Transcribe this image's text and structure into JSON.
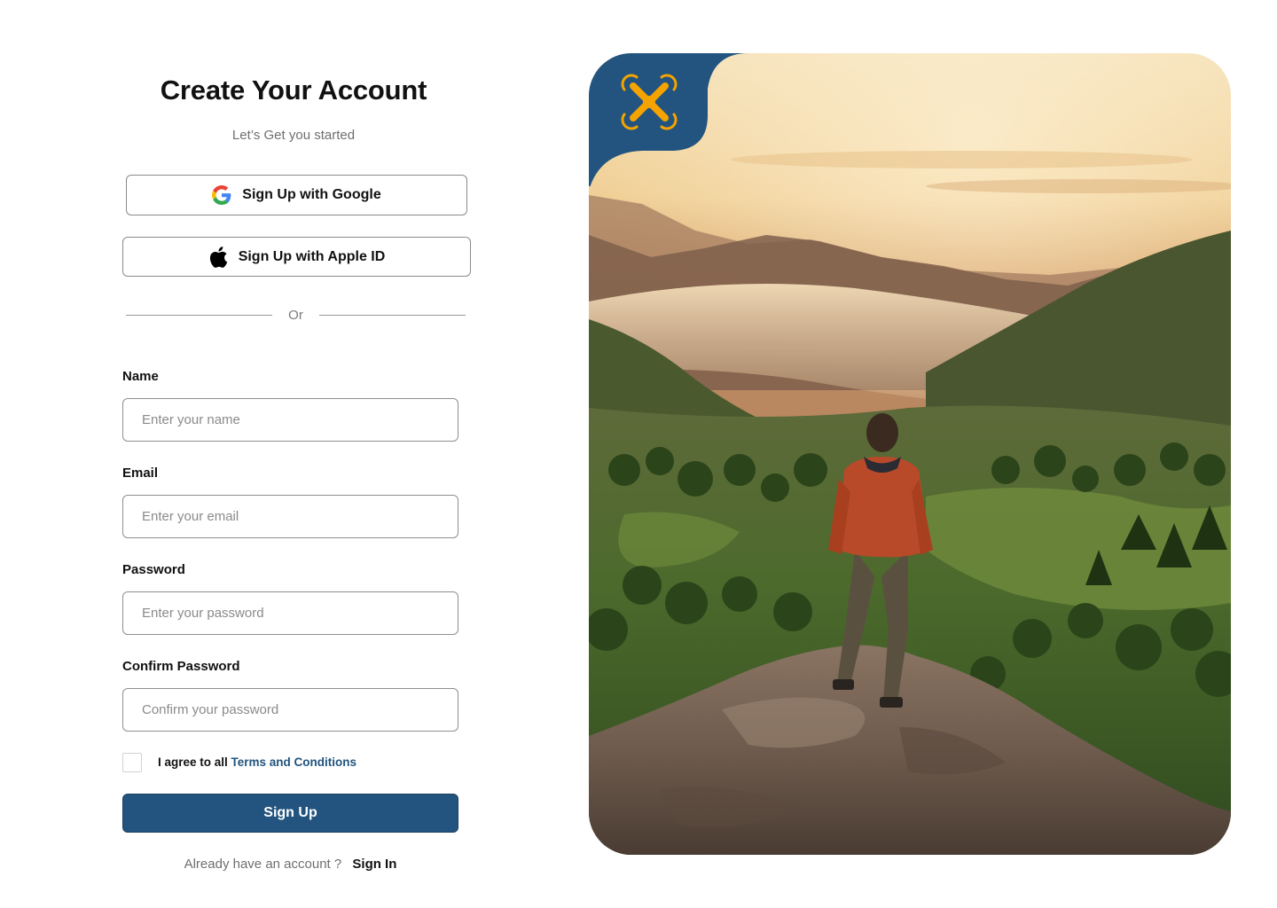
{
  "header": {
    "title": "Create Your Account",
    "subtitle": "Let’s Get you started"
  },
  "oauth": {
    "google_label": "Sign Up with Google",
    "apple_label": "Sign Up with Apple ID",
    "google_icon": "google-icon",
    "apple_icon": "apple-icon"
  },
  "divider": {
    "text": "Or"
  },
  "form": {
    "name": {
      "label": "Name",
      "placeholder": "Enter your name",
      "value": ""
    },
    "email": {
      "label": "Email",
      "placeholder": "Enter your email",
      "value": ""
    },
    "password": {
      "label": "Password",
      "placeholder": "Enter your password",
      "value": ""
    },
    "confirm_password": {
      "label": "Confirm Password",
      "placeholder": "Confirm your password",
      "value": ""
    },
    "agree": {
      "prefix": "I agree to all ",
      "link": "Terms and Conditions",
      "checked": false
    },
    "submit_label": "Sign Up"
  },
  "footer": {
    "prompt": "Already have an account ?",
    "signin_label": "Sign In"
  },
  "brand": {
    "logo_icon": "drone-icon",
    "accent": "#22547f",
    "logo_color": "#f5a300"
  },
  "hero": {
    "image": "hiker-on-rock-overlooking-misty-valley"
  }
}
